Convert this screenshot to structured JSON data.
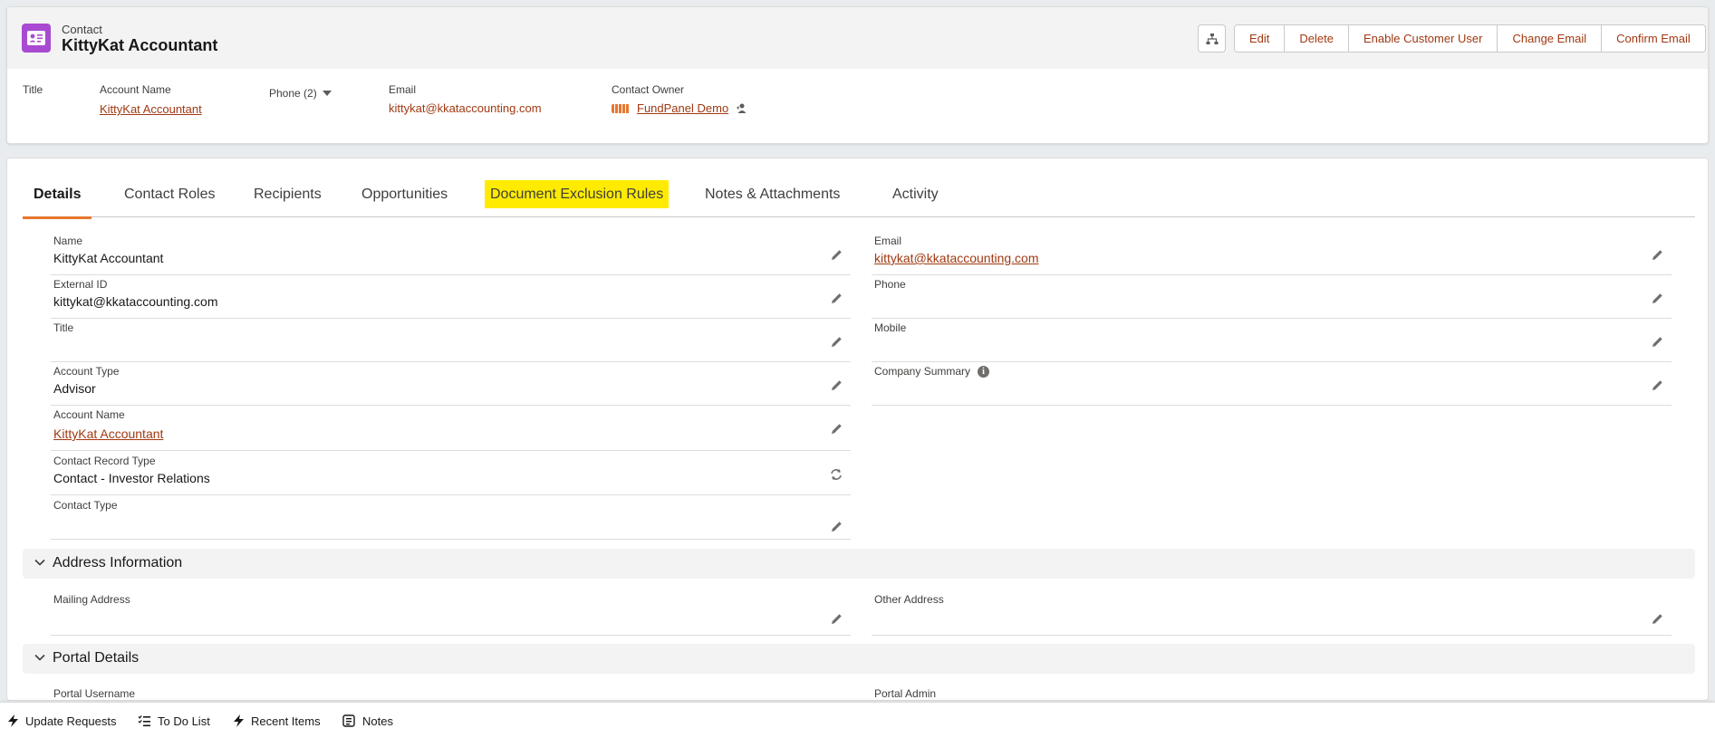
{
  "header": {
    "object_type": "Contact",
    "record_name": "KittyKat Accountant",
    "buttons": [
      "Edit",
      "Delete",
      "Enable Customer User",
      "Change Email",
      "Confirm Email"
    ],
    "highlights": {
      "title_label": "Title",
      "account_name_label": "Account Name",
      "account_name_value": "KittyKat Accountant",
      "phone_label": "Phone (2)",
      "email_label": "Email",
      "email_value": "kittykat@kkataccounting.com",
      "owner_label": "Contact Owner",
      "owner_value": "FundPanel Demo"
    }
  },
  "tabs": [
    "Details",
    "Contact Roles",
    "Recipients",
    "Opportunities",
    "Document Exclusion Rules",
    "Notes & Attachments",
    "Activity"
  ],
  "active_tab": "Details",
  "highlighted_tab": "Document Exclusion Rules",
  "fields_left": [
    {
      "label": "Name",
      "value": "KittyKat Accountant"
    },
    {
      "label": "External ID",
      "value": "kittykat@kkataccounting.com"
    },
    {
      "label": "Title",
      "value": ""
    },
    {
      "label": "Account Type",
      "value": "Advisor"
    },
    {
      "label": "Account Name",
      "value": "KittyKat Accountant"
    },
    {
      "label": "Contact Record Type",
      "value": "Contact - Investor Relations"
    },
    {
      "label": "Contact Type",
      "value": ""
    }
  ],
  "fields_right": [
    {
      "label": "Email",
      "value": "kittykat@kkataccounting.com"
    },
    {
      "label": "Phone",
      "value": ""
    },
    {
      "label": "Mobile",
      "value": ""
    },
    {
      "label": "Company Summary",
      "value": ""
    }
  ],
  "sections": {
    "address": {
      "title": "Address Information",
      "mailing_label": "Mailing Address",
      "other_label": "Other Address"
    },
    "portal": {
      "title": "Portal Details",
      "username_label": "Portal Username",
      "admin_label": "Portal Admin"
    }
  },
  "utility_bar": [
    "Update Requests",
    "To Do List",
    "Recent Items",
    "Notes"
  ],
  "colors": {
    "link": "#a03912",
    "accent": "#e8772e",
    "highlight": "#ffeb00",
    "contact_icon": "#a94ad3"
  }
}
